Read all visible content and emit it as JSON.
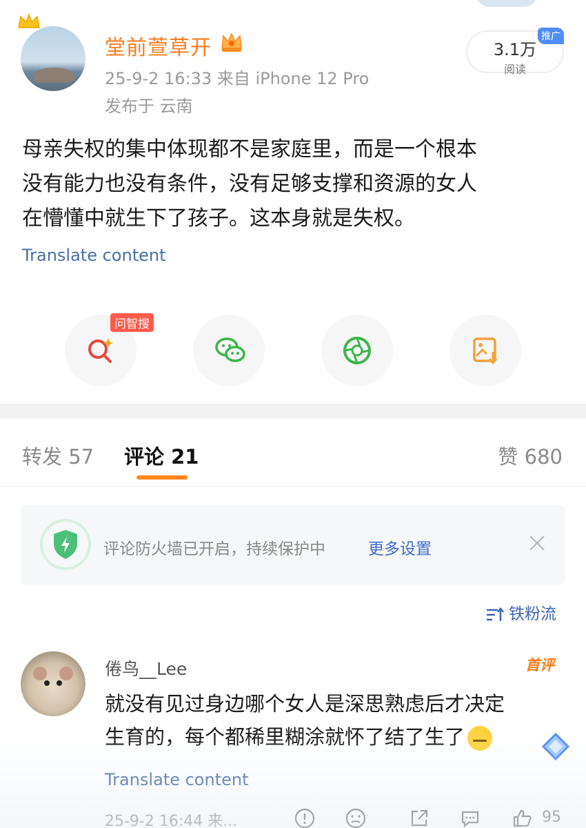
{
  "post": {
    "author": "堂前萱草开",
    "meta": "25-9-2 16:33  来自 iPhone 12 Pro",
    "location": "发布于 云南",
    "reads": {
      "value": "3.1万",
      "label": "阅读",
      "badge": "推广"
    },
    "text_lines": [
      "母亲失权的集中体现都不是家庭里，而是一个根本",
      "没有能力也没有条件，没有足够支撑和资源的女人",
      "在懵懂中就生下了孩子。这本身就是失权。"
    ],
    "translate": "Translate content",
    "actions": [
      {
        "name": "ai-search",
        "badge": "问智搜",
        "icon": "search-sparkle-icon",
        "color": "#e8453c"
      },
      {
        "name": "wechat-share",
        "icon": "wechat-icon",
        "color": "#3bb64a"
      },
      {
        "name": "moments-share",
        "icon": "shutter-icon",
        "color": "#3bb64a"
      },
      {
        "name": "save-image",
        "icon": "image-download-icon",
        "color": "#f2a33a"
      }
    ]
  },
  "tabs": {
    "repost": "转发 57",
    "comments": "评论 21",
    "likes": "赞 680"
  },
  "firewall": {
    "text": "评论防火墙已开启，持续保护中",
    "link": "更多设置"
  },
  "sort": {
    "label": "铁粉流"
  },
  "comment": {
    "user": "倦鸟__Lee",
    "badge": "首评",
    "text_lines": [
      "就没有见过身边哪个女人是深思熟虑后才决定",
      "生育的，每个都稀里糊涂就怀了结了生了"
    ],
    "translate": "Translate content",
    "footer": "25-9-2 16:44 来...",
    "likes": "95"
  },
  "colors": {
    "accent_orange": "#ff7a1a",
    "link_blue": "#4a6ea8",
    "badge_blue": "#4f8df7"
  }
}
